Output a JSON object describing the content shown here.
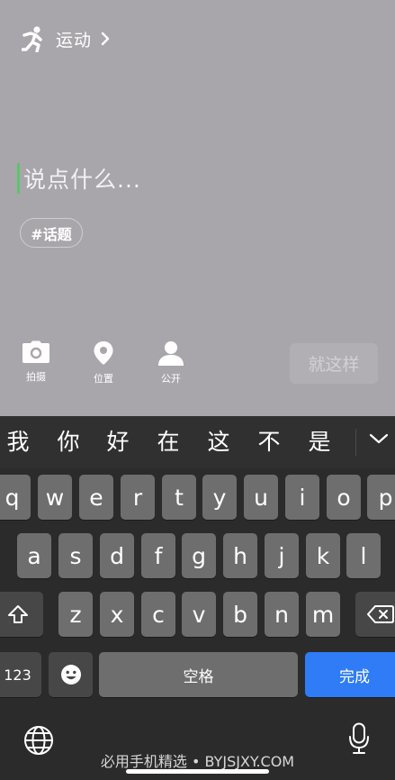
{
  "header": {
    "sport_label": "运动"
  },
  "composer": {
    "placeholder": "说点什么..."
  },
  "topic_tag": "#话题",
  "tools": {
    "photo": "拍摄",
    "location": "位置",
    "visibility": "公开"
  },
  "submit_label": "就这样",
  "candidates": [
    "我",
    "你",
    "好",
    "在",
    "这",
    "不",
    "是"
  ],
  "keyboard": {
    "row1": [
      "q",
      "w",
      "e",
      "r",
      "t",
      "y",
      "u",
      "i",
      "o",
      "p"
    ],
    "row2": [
      "a",
      "s",
      "d",
      "f",
      "g",
      "h",
      "j",
      "k",
      "l"
    ],
    "row3": [
      "z",
      "x",
      "c",
      "v",
      "b",
      "n",
      "m"
    ],
    "numbers_key": "123",
    "space_key": "空格",
    "done_key": "完成"
  },
  "watermark": "必用手机精选 • BYJSJXY.COM",
  "colors": {
    "accent": "#2f7cf6",
    "caret": "#5cc46a",
    "compose_bg": "#a8a6ab"
  }
}
